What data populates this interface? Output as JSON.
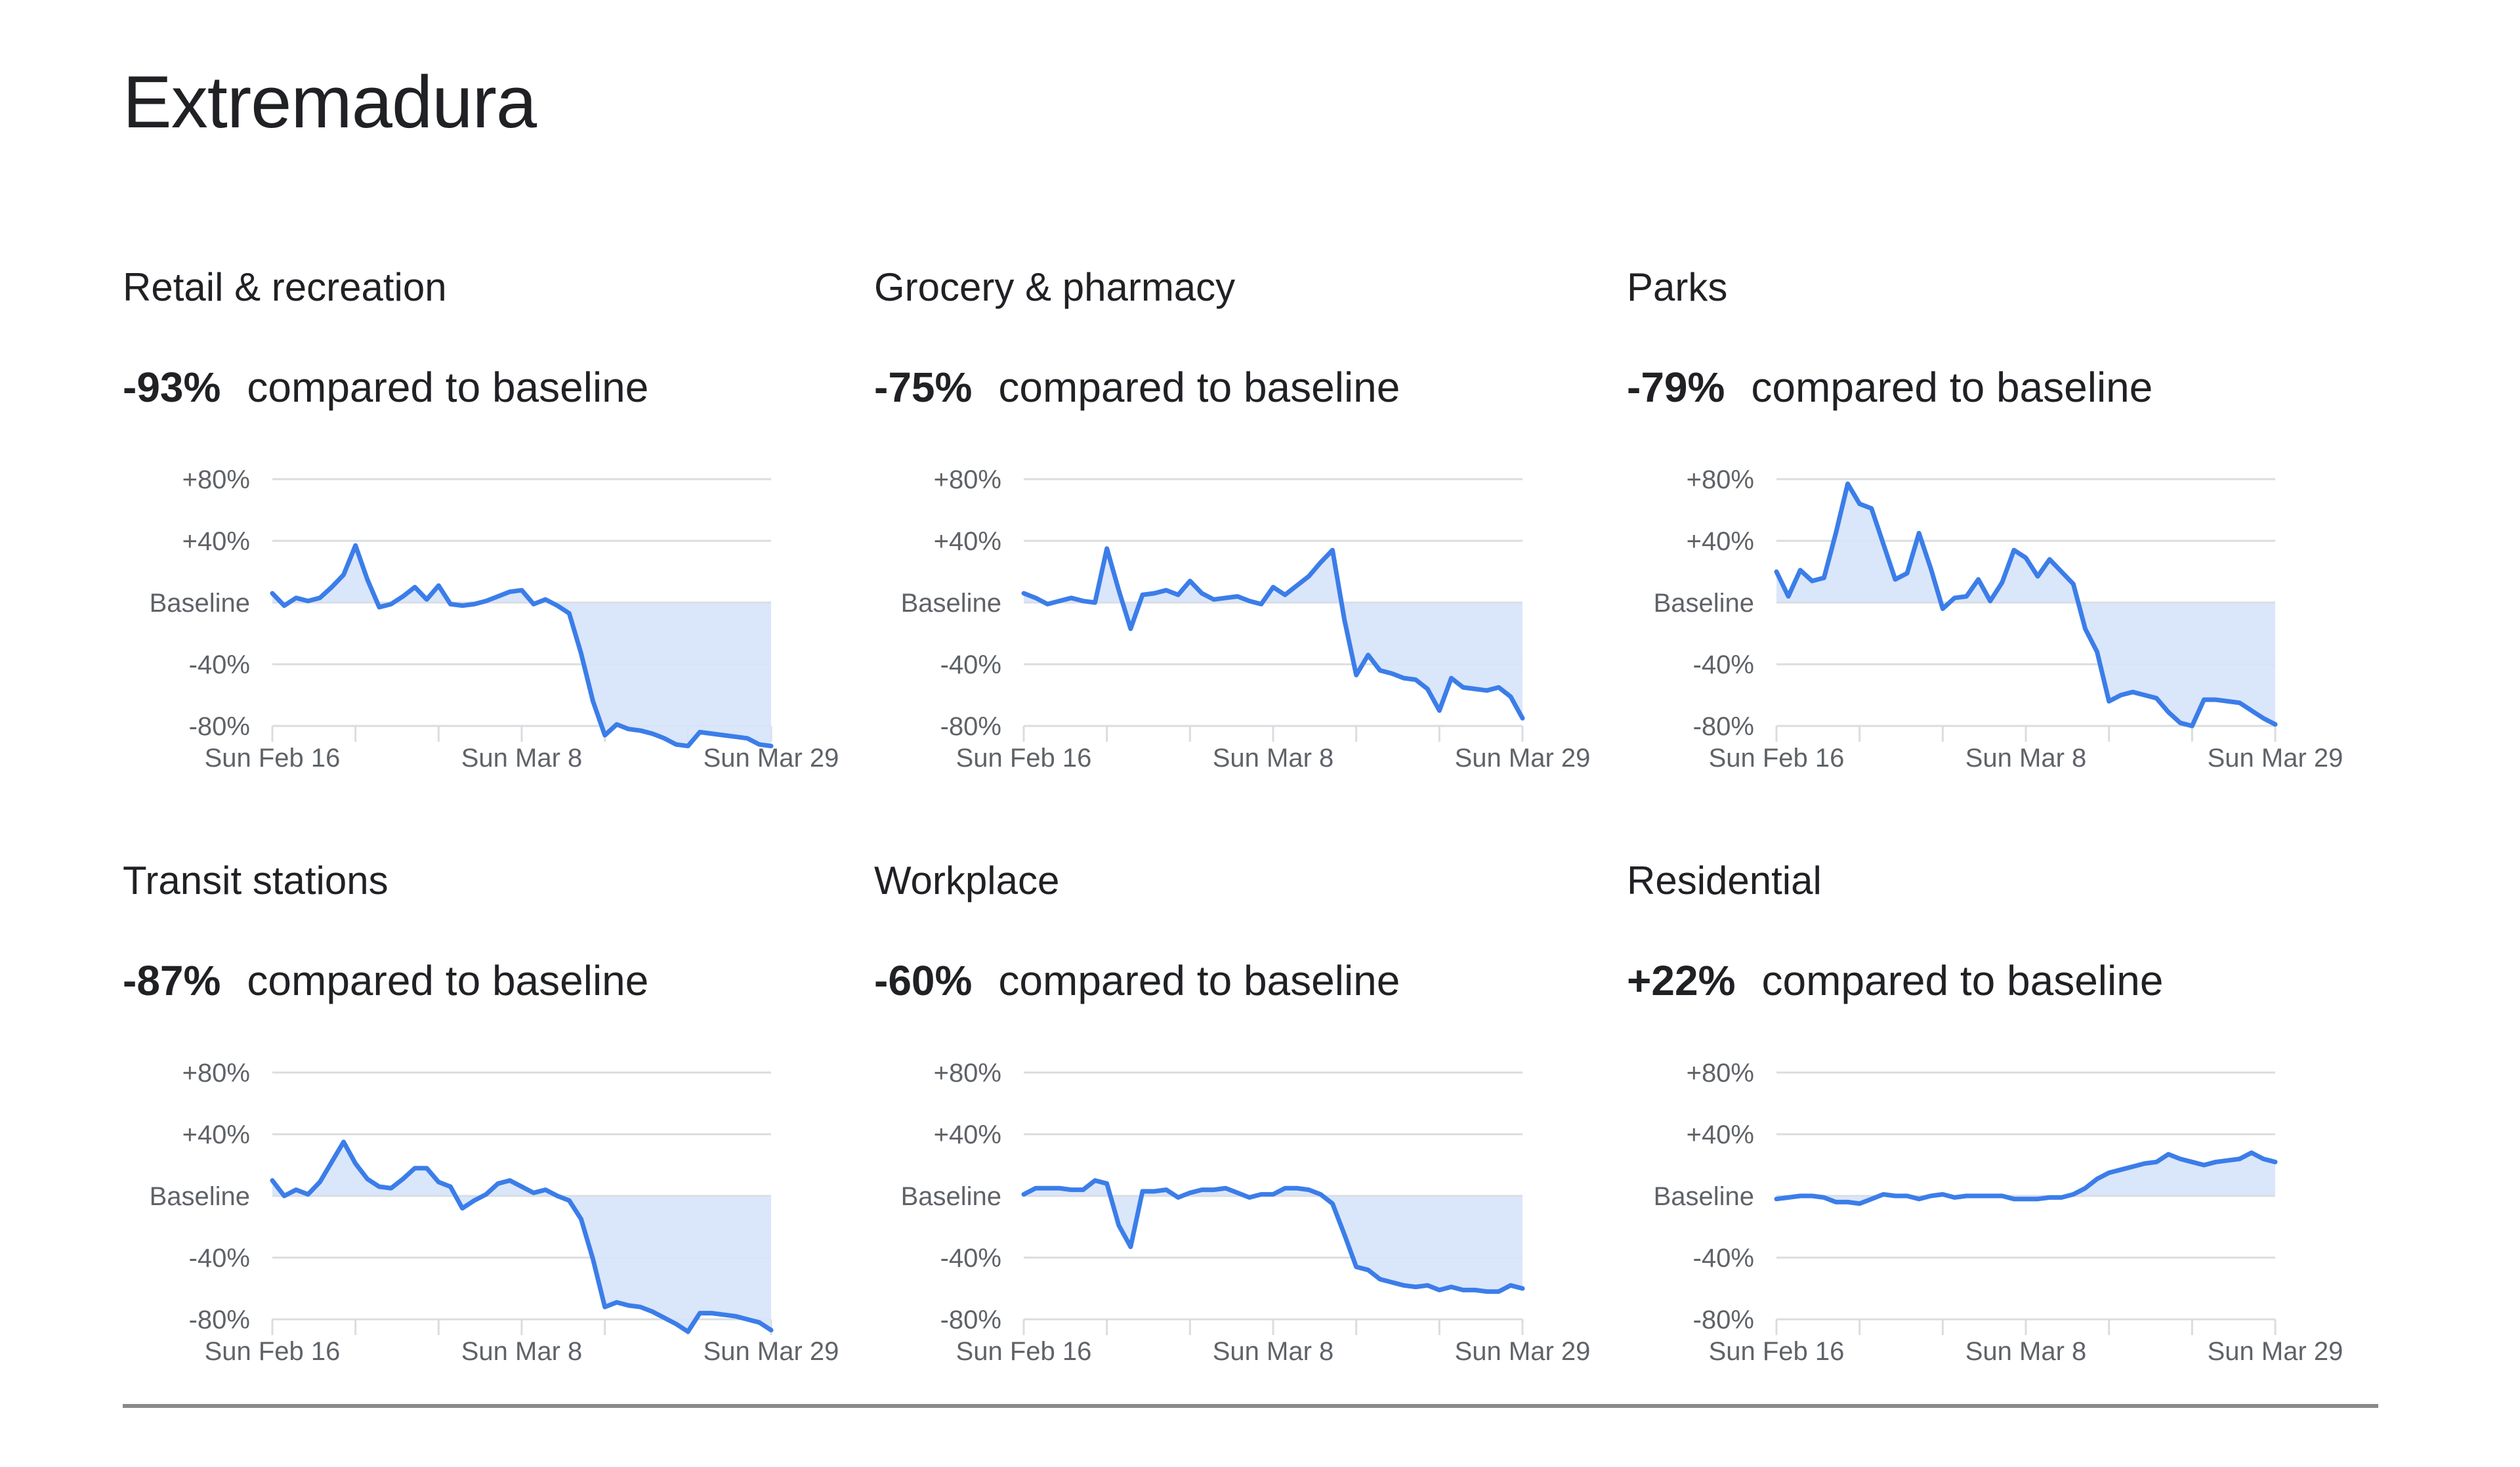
{
  "page": {
    "title": "Extremadura",
    "stat_suffix": "compared to baseline"
  },
  "colors": {
    "line": "#3b7de9",
    "fill": "#d6e3fa",
    "grid": "#dadce0",
    "tick_text": "#5f6368",
    "text": "#202124",
    "divider": "#8a8a8a"
  },
  "chart_data": [
    {
      "type": "area",
      "title": "Retail & recreation",
      "headline": "-93%",
      "x_start": "2020-02-16",
      "x_end": "2020-03-29",
      "x_tick_labels": [
        "Sun Feb 16",
        "Sun Mar 8",
        "Sun Mar 29"
      ],
      "y_tick_labels": [
        "+80%",
        "+40%",
        "Baseline",
        "-40%",
        "-80%"
      ],
      "y_ticks": [
        80,
        40,
        0,
        -40,
        -80
      ],
      "ylim": [
        -80,
        80
      ],
      "grid": true,
      "baseline_fill": true,
      "values": [
        6,
        -2,
        3,
        1,
        3,
        10,
        18,
        37,
        15,
        -3,
        -1,
        4,
        10,
        2,
        11,
        -1,
        -2,
        -1,
        1,
        4,
        7,
        8,
        -1,
        2,
        -2,
        -7,
        -33,
        -64,
        -86,
        -79,
        -82,
        -83,
        -85,
        -88,
        -92,
        -93,
        -84,
        -85,
        -86,
        -87,
        -88,
        -92,
        -93
      ]
    },
    {
      "type": "area",
      "title": "Grocery & pharmacy",
      "headline": "-75%",
      "x_start": "2020-02-16",
      "x_end": "2020-03-29",
      "x_tick_labels": [
        "Sun Feb 16",
        "Sun Mar 8",
        "Sun Mar 29"
      ],
      "y_tick_labels": [
        "+80%",
        "+40%",
        "Baseline",
        "-40%",
        "-80%"
      ],
      "y_ticks": [
        80,
        40,
        0,
        -40,
        -80
      ],
      "ylim": [
        -80,
        80
      ],
      "grid": true,
      "baseline_fill": true,
      "values": [
        6,
        3,
        -1,
        1,
        3,
        1,
        0,
        35,
        8,
        -17,
        5,
        6,
        8,
        5,
        14,
        6,
        2,
        3,
        4,
        1,
        -1,
        10,
        5,
        11,
        17,
        26,
        34,
        -11,
        -47,
        -34,
        -44,
        -46,
        -49,
        -50,
        -56,
        -70,
        -49,
        -55,
        -56,
        -57,
        -55,
        -61,
        -75
      ]
    },
    {
      "type": "area",
      "title": "Parks",
      "headline": "-79%",
      "x_start": "2020-02-16",
      "x_end": "2020-03-29",
      "x_tick_labels": [
        "Sun Feb 16",
        "Sun Mar 8",
        "Sun Mar 29"
      ],
      "y_tick_labels": [
        "+80%",
        "+40%",
        "Baseline",
        "-40%",
        "-80%"
      ],
      "y_ticks": [
        80,
        40,
        0,
        -40,
        -80
      ],
      "ylim": [
        -80,
        80
      ],
      "grid": true,
      "baseline_fill": true,
      "values": [
        20,
        4,
        21,
        14,
        16,
        45,
        77,
        64,
        61,
        38,
        15,
        19,
        45,
        22,
        -4,
        3,
        4,
        15,
        1,
        13,
        34,
        29,
        17,
        28,
        20,
        12,
        -17,
        -32,
        -64,
        -60,
        -58,
        -60,
        -62,
        -71,
        -78,
        -80,
        -63,
        -63,
        -64,
        -65,
        -70,
        -75,
        -79
      ]
    },
    {
      "type": "area",
      "title": "Transit stations",
      "headline": "-87%",
      "x_start": "2020-02-16",
      "x_end": "2020-03-29",
      "x_tick_labels": [
        "Sun Feb 16",
        "Sun Mar 8",
        "Sun Mar 29"
      ],
      "y_tick_labels": [
        "+80%",
        "+40%",
        "Baseline",
        "-40%",
        "-80%"
      ],
      "y_ticks": [
        80,
        40,
        0,
        -40,
        -80
      ],
      "ylim": [
        -80,
        80
      ],
      "grid": true,
      "baseline_fill": true,
      "values": [
        10,
        0,
        4,
        1,
        9,
        22,
        35,
        21,
        11,
        6,
        5,
        11,
        18,
        18,
        9,
        6,
        -8,
        -3,
        1,
        8,
        10,
        6,
        2,
        4,
        0,
        -3,
        -15,
        -41,
        -72,
        -69,
        -71,
        -72,
        -75,
        -79,
        -83,
        -88,
        -76,
        -76,
        -77,
        -78,
        -80,
        -82,
        -87
      ]
    },
    {
      "type": "area",
      "title": "Workplace",
      "headline": "-60%",
      "x_start": "2020-02-16",
      "x_end": "2020-03-29",
      "x_tick_labels": [
        "Sun Feb 16",
        "Sun Mar 8",
        "Sun Mar 29"
      ],
      "y_tick_labels": [
        "+80%",
        "+40%",
        "Baseline",
        "-40%",
        "-80%"
      ],
      "y_ticks": [
        80,
        40,
        0,
        -40,
        -80
      ],
      "ylim": [
        -80,
        80
      ],
      "grid": true,
      "baseline_fill": true,
      "values": [
        1,
        5,
        5,
        5,
        4,
        4,
        10,
        8,
        -19,
        -33,
        3,
        3,
        4,
        -1,
        2,
        4,
        4,
        5,
        2,
        -1,
        1,
        1,
        5,
        5,
        4,
        1,
        -5,
        -25,
        -46,
        -48,
        -54,
        -56,
        -58,
        -59,
        -58,
        -61,
        -59,
        -61,
        -61,
        -62,
        -62,
        -58,
        -60
      ]
    },
    {
      "type": "area",
      "title": "Residential",
      "headline": "+22%",
      "x_start": "2020-02-16",
      "x_end": "2020-03-29",
      "x_tick_labels": [
        "Sun Feb 16",
        "Sun Mar 8",
        "Sun Mar 29"
      ],
      "y_tick_labels": [
        "+80%",
        "+40%",
        "Baseline",
        "-40%",
        "-80%"
      ],
      "y_ticks": [
        80,
        40,
        0,
        -40,
        -80
      ],
      "ylim": [
        -80,
        80
      ],
      "grid": true,
      "baseline_fill": true,
      "values": [
        -2,
        -1,
        0,
        0,
        -1,
        -4,
        -4,
        -5,
        -2,
        1,
        0,
        0,
        -2,
        0,
        1,
        -1,
        0,
        0,
        0,
        0,
        -2,
        -2,
        -2,
        -1,
        -1,
        1,
        5,
        11,
        15,
        17,
        19,
        21,
        22,
        27,
        24,
        22,
        20,
        22,
        23,
        24,
        28,
        24,
        22
      ]
    }
  ]
}
